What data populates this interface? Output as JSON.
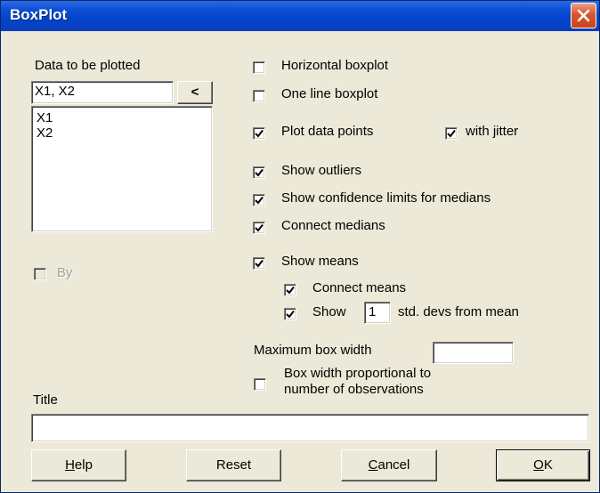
{
  "window": {
    "title": "BoxPlot"
  },
  "data_panel": {
    "label": "Data to be plotted",
    "selection_value": "X1, X2",
    "move_button": "<",
    "variables": [
      "X1",
      "X2"
    ],
    "by_label": "By",
    "by_checked": false,
    "by_enabled": false
  },
  "options": {
    "horizontal": {
      "label": "Horizontal boxplot",
      "checked": false
    },
    "one_line": {
      "label": "One line boxplot",
      "checked": false
    },
    "plot_points": {
      "label": "Plot data points",
      "checked": true
    },
    "jitter": {
      "label": "with jitter",
      "checked": true
    },
    "outliers": {
      "label": "Show outliers",
      "checked": true
    },
    "confidence": {
      "label": "Show confidence limits for medians",
      "checked": true
    },
    "connect_medians": {
      "label": "Connect medians",
      "checked": true
    },
    "show_means": {
      "label": "Show means",
      "checked": true
    },
    "connect_means": {
      "label": "Connect means",
      "checked": true
    },
    "show_sd": {
      "label_prefix": "Show",
      "value": "1",
      "label_suffix": "std. devs from mean",
      "checked": true
    },
    "max_width": {
      "label": "Maximum box width",
      "value": ""
    },
    "proportional": {
      "label_line1": "Box width proportional to",
      "label_line2": "number of observations",
      "checked": false
    }
  },
  "title_field": {
    "label": "Title",
    "value": ""
  },
  "buttons": {
    "help": {
      "underlined": "H",
      "rest": "elp"
    },
    "reset": {
      "label": "Reset"
    },
    "cancel": {
      "underlined": "C",
      "rest": "ancel"
    },
    "ok": {
      "underlined": "O",
      "rest": "K"
    }
  }
}
